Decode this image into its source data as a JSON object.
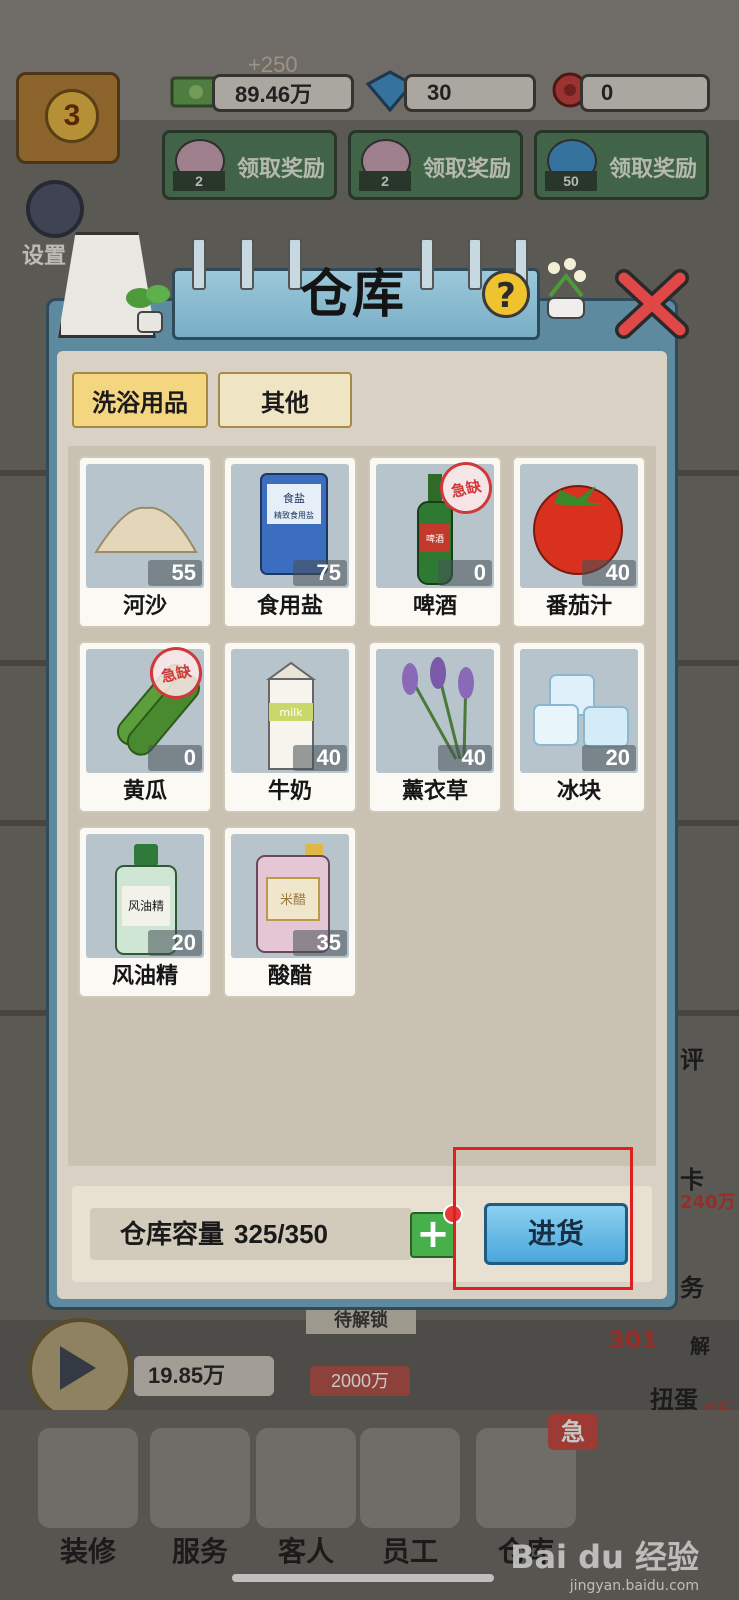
{
  "top_bar": {
    "level": "3",
    "bonus_text": "+250",
    "cash": "89.46万",
    "diamonds": "30",
    "roses": "0",
    "reward_buttons": [
      {
        "label": "领取奖励",
        "count": "2",
        "icon": "flower-bag-icon"
      },
      {
        "label": "领取奖励",
        "count": "2",
        "icon": "flower-bag-icon"
      },
      {
        "label": "领取奖励",
        "count": "50",
        "icon": "diamond-icon"
      }
    ],
    "settings_label": "设置"
  },
  "panel": {
    "title": "仓库",
    "help_symbol": "?",
    "tabs": [
      {
        "label": "洗浴用品",
        "active": true
      },
      {
        "label": "其他",
        "active": false
      }
    ],
    "items": [
      {
        "name": "河沙",
        "count": "55",
        "shortage": false,
        "icon": "sand-pile-icon"
      },
      {
        "name": "食用盐",
        "count": "75",
        "shortage": false,
        "icon": "salt-bag-icon",
        "pack_text": "食盐",
        "pack_sub": "精致食用盐"
      },
      {
        "name": "啤酒",
        "count": "0",
        "shortage": true,
        "icon": "beer-bottle-icon",
        "label_text": "啤酒"
      },
      {
        "name": "番茄汁",
        "count": "40",
        "shortage": false,
        "icon": "tomato-icon"
      },
      {
        "name": "黄瓜",
        "count": "0",
        "shortage": true,
        "icon": "cucumber-icon"
      },
      {
        "name": "牛奶",
        "count": "40",
        "shortage": false,
        "icon": "milk-carton-icon",
        "label_text": "milk"
      },
      {
        "name": "薰衣草",
        "count": "40",
        "shortage": false,
        "icon": "lavender-icon"
      },
      {
        "name": "冰块",
        "count": "20",
        "shortage": false,
        "icon": "ice-cubes-icon"
      },
      {
        "name": "风油精",
        "count": "20",
        "shortage": false,
        "icon": "ointment-bottle-icon",
        "label_text": "风油精"
      },
      {
        "name": "酸醋",
        "count": "35",
        "shortage": false,
        "icon": "vinegar-jug-icon",
        "label_text": "米醋"
      }
    ],
    "shortage_stamp": "急缺",
    "capacity_label": "仓库容量",
    "capacity_value": "325/350",
    "plus_symbol": "+",
    "restock_label": "进货"
  },
  "background": {
    "money_left": "19.85万",
    "money_tag": "2000万",
    "unlock_text": "待解锁",
    "right_count": "301",
    "right_labels": [
      "评",
      "卡",
      "240万",
      "务",
      "解",
      "扭蛋",
      "0万"
    ],
    "urgent_tag": "急"
  },
  "bottom_nav": [
    {
      "label": "装修",
      "icon": "paint-brush-icon"
    },
    {
      "label": "服务",
      "icon": "service-icon"
    },
    {
      "label": "客人",
      "icon": "guest-icon"
    },
    {
      "label": "员工",
      "icon": "staff-icon"
    },
    {
      "label": "仓库",
      "icon": "warehouse-icon"
    }
  ],
  "watermark": {
    "main": "Bai du 经验",
    "sub": "jingyan.baidu.com"
  },
  "colors": {
    "panel_blue": "#5e8aa0",
    "tab_active": "#f5d680",
    "restock_button": "#4aa6dc",
    "highlight_red": "#e02020",
    "count_green": "#2f8a2f"
  }
}
